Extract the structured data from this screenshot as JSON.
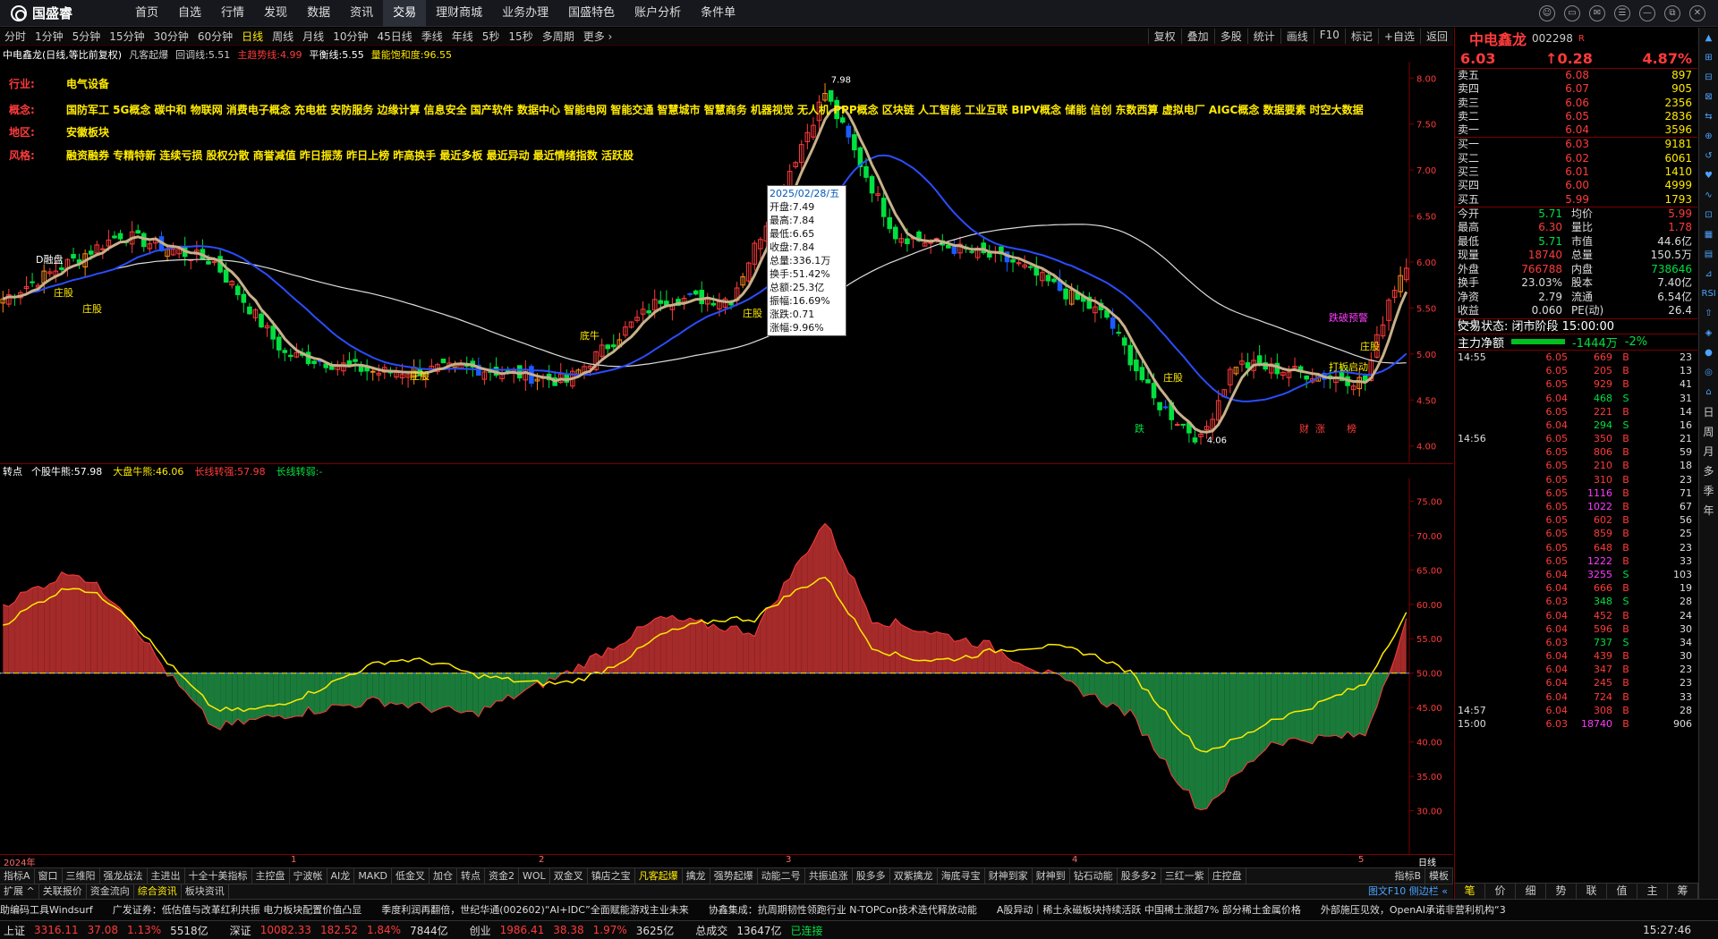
{
  "app": {
    "name": "国盛睿"
  },
  "nav": {
    "items": [
      "首页",
      "自选",
      "行情",
      "发现",
      "数据",
      "资讯",
      "交易",
      "理财商城",
      "业务办理",
      "国盛特色",
      "账户分析",
      "条件单"
    ],
    "active": 6,
    "window_controls": [
      "☺",
      "▭",
      "✉",
      "☰",
      "—",
      "⧉",
      "✕"
    ]
  },
  "periods": {
    "items": [
      "分时",
      "1分钟",
      "5分钟",
      "15分钟",
      "30分钟",
      "60分钟",
      "日线",
      "周线",
      "月线",
      "10分钟",
      "45日线",
      "季线",
      "年线",
      "5秒",
      "15秒",
      "多周期",
      "更多 ›"
    ],
    "active": 6
  },
  "tools": [
    "复权",
    "叠加",
    "多股",
    "统计",
    "画线",
    "F10",
    "标记",
    "+自选",
    "返回"
  ],
  "info": {
    "stock": "中电鑫龙(日线,等比前复权)",
    "indicator": "凡客起爆",
    "items": [
      {
        "k": "回调线:",
        "v": "5.51"
      },
      {
        "k": "主趋势线:",
        "v": "4.99"
      },
      {
        "k": "平衡线:",
        "v": "5.55"
      },
      {
        "k": "量能饱和度:",
        "v": "96.55"
      }
    ]
  },
  "annotations": [
    {
      "k": "行业:",
      "v": "电气设备"
    },
    {
      "k": "概念:",
      "v": "国防军工 5G概念 碳中和 物联网 消费电子概念 充电桩 安防服务 边缘计算 信息安全 国产软件 数据中心 智能电网 智能交通 智慧城市 智慧商务 机器视觉 无人机 PPP概念 区块链 人工智能 工业互联 BIPV概念 储能 信创 东数西算 虚拟电厂 AIGC概念 数据要素 时空大数据"
    },
    {
      "k": "地区:",
      "v": "安徽板块"
    },
    {
      "k": "风格:",
      "v": "融资融券 专精特新 连续亏损 股权分散 商誉减值 昨日振荡 昨日上榜 昨高换手 最近多板 最近异动 最近情绪指数 活跃股"
    }
  ],
  "chart_data": [
    {
      "type": "candlestick",
      "ylim": [
        3.9,
        8.1
      ],
      "yticks": [
        "8.00",
        "7.50",
        "7.00",
        "6.50",
        "6.00",
        "5.50",
        "5.00",
        "4.50",
        "4.00"
      ],
      "high_label": "7.98",
      "low_label": "4.06",
      "marks": [
        "D融盘",
        "庄股",
        "庄股",
        "庄股",
        "底牛",
        "庄股",
        "庄股",
        "跌破预警",
        "庄股",
        "打板启动",
        "跌",
        "财",
        "涨",
        "榜"
      ]
    },
    {
      "type": "area",
      "ylim": [
        25,
        77
      ],
      "yticks": [
        "75.00",
        "70.00",
        "65.00",
        "60.00",
        "55.00",
        "50.00",
        "45.00",
        "40.00",
        "35.00",
        "30.00"
      ],
      "series": [
        {
          "name": "个股牛熊",
          "last": "57.98",
          "color": "#ffffff"
        },
        {
          "name": "大盘牛熊",
          "last": "46.06",
          "color": "#ffea00"
        },
        {
          "name": "长线转强",
          "last": "57.98",
          "color": "#ff3b3b"
        },
        {
          "name": "长线转弱",
          "last": "-",
          "color": "#00e040"
        }
      ],
      "baseline": 50
    }
  ],
  "tooltip": {
    "date": "2025/02/28/五",
    "rows": [
      "开盘:7.49",
      "最高:7.84",
      "最低:6.65",
      "收盘:7.84",
      "总量:336.1万",
      "换手:51.42%",
      "总额:25.3亿",
      "振幅:16.69%",
      "涨跌:0.71",
      "涨幅:9.96%"
    ]
  },
  "subinfo": {
    "title": "转点",
    "items": [
      {
        "k": "个股牛熊:",
        "v": "57.98",
        "c": "#fff"
      },
      {
        "k": "大盘牛熊:",
        "v": "46.06",
        "c": "#ffea00"
      },
      {
        "k": "长线转强:",
        "v": "57.98",
        "c": "#ff3b3b"
      },
      {
        "k": "长线转弱:",
        "v": "-",
        "c": "#00e040"
      }
    ]
  },
  "timeaxis": {
    "labels": [
      "2024年",
      "1",
      "2",
      "3",
      "4",
      "5"
    ],
    "right": "日线"
  },
  "tabs1": {
    "items": [
      "指标A",
      "窗口",
      "三维阳",
      "强龙战法",
      "主进出",
      "十全十美指标",
      "主控盘",
      "宁波帐",
      "AI龙",
      "MAKD",
      "低金叉",
      "加仓",
      "转点",
      "资金2",
      "WOL",
      "双金叉",
      "镇店之宝",
      "凡客起爆",
      "擒龙",
      "强势起爆",
      "动能二号",
      "共振追涨",
      "股多多",
      "双紫擒龙",
      "海底寻宝",
      "财神到家",
      "财神到",
      "钻石动能",
      "股多多2",
      "三红一紫",
      "庄控盘"
    ],
    "active": 17,
    "right": [
      "指标B",
      "模板"
    ]
  },
  "tabs2": {
    "items": [
      "扩展 ^",
      "关联报价",
      "资金流向",
      "综合资讯",
      "板块资讯"
    ],
    "right": "图文F10 侧边栏 «"
  },
  "news": [
    "助编码工具Windsurf",
    "广发证券：低估值与改革红利共振 电力板块配置价值凸显",
    "季度利润再翻倍，世纪华通(002602)“AI+IDC”全面赋能游戏主业未来",
    "协鑫集成：抗周期韧性领跑行业 N-TOPCon技术迭代释放动能",
    "A股异动｜稀土永磁板块持续活跃 中国稀土涨超7% 部分稀土金属价格",
    "外部施压见效，OpenAI承诺非营利机构“3"
  ],
  "status": {
    "indices": [
      {
        "name": "上证",
        "val": "3316.11",
        "chg": "37.08",
        "pct": "1.13%",
        "amt": "5518亿"
      },
      {
        "name": "深证",
        "val": "10082.33",
        "chg": "182.52",
        "pct": "1.84%",
        "amt": "7844亿"
      },
      {
        "name": "创业",
        "val": "1986.41",
        "chg": "38.38",
        "pct": "1.97%",
        "amt": "3625亿"
      }
    ],
    "total_label": "总成交",
    "total": "13647亿",
    "conn": "已连接",
    "time": "15:27:46"
  },
  "quote": {
    "name": "中电鑫龙",
    "code": "002298",
    "tag": "R",
    "price": "6.03",
    "change": "0.28",
    "pct": "4.87%",
    "asks": [
      {
        "l": "卖五",
        "p": "6.08",
        "v": "897"
      },
      {
        "l": "卖四",
        "p": "6.07",
        "v": "905"
      },
      {
        "l": "卖三",
        "p": "6.06",
        "v": "2356"
      },
      {
        "l": "卖二",
        "p": "6.05",
        "v": "2836"
      },
      {
        "l": "卖一",
        "p": "6.04",
        "v": "3596"
      }
    ],
    "bids": [
      {
        "l": "买一",
        "p": "6.03",
        "v": "9181"
      },
      {
        "l": "买二",
        "p": "6.02",
        "v": "6061"
      },
      {
        "l": "买三",
        "p": "6.01",
        "v": "1410"
      },
      {
        "l": "买四",
        "p": "6.00",
        "v": "4999"
      },
      {
        "l": "买五",
        "p": "5.99",
        "v": "1793"
      }
    ],
    "stats": [
      {
        "k": "今开",
        "a": "5.71",
        "ac": "#00e040",
        "k2": "均价",
        "b": "5.99",
        "bc": "#ff3b3b"
      },
      {
        "k": "最高",
        "a": "6.30",
        "ac": "#ff3b3b",
        "k2": "量比",
        "b": "1.78",
        "bc": "#ff3b3b"
      },
      {
        "k": "最低",
        "a": "5.71",
        "ac": "#00e040",
        "k2": "市值",
        "b": "44.6亿",
        "bc": "#ddd"
      },
      {
        "k": "现量",
        "a": "18740",
        "ac": "#ff3b3b",
        "k2": "总量",
        "b": "150.5万",
        "bc": "#ddd"
      },
      {
        "k": "外盘",
        "a": "766788",
        "ac": "#ff3b3b",
        "k2": "内盘",
        "b": "738646",
        "bc": "#00e040"
      },
      {
        "k": "换手",
        "a": "23.03%",
        "ac": "#ddd",
        "k2": "股本",
        "b": "7.40亿",
        "bc": "#ddd"
      },
      {
        "k": "净资",
        "a": "2.79",
        "ac": "#ddd",
        "k2": "流通",
        "b": "6.54亿",
        "bc": "#ddd"
      },
      {
        "k": "收益(一)",
        "a": "0.060",
        "ac": "#ddd",
        "k2": "PE(动)",
        "b": "26.4",
        "bc": "#ddd"
      }
    ],
    "trade_state": "交易状态: 闭市阶段 15:00:00",
    "netflow": {
      "label": "主力净额",
      "val": "-1444万",
      "pct": "-2%"
    },
    "ticks": [
      {
        "t": "14:55",
        "p": "6.05",
        "v": "669",
        "s": "B",
        "n": "23"
      },
      {
        "t": "",
        "p": "6.05",
        "v": "205",
        "s": "B",
        "n": "13"
      },
      {
        "t": "",
        "p": "6.05",
        "v": "929",
        "s": "B",
        "n": "41"
      },
      {
        "t": "",
        "p": "6.04",
        "v": "468",
        "s": "S",
        "n": "31"
      },
      {
        "t": "",
        "p": "6.05",
        "v": "221",
        "s": "B",
        "n": "14"
      },
      {
        "t": "",
        "p": "6.04",
        "v": "294",
        "s": "S",
        "n": "16"
      },
      {
        "t": "14:56",
        "p": "6.05",
        "v": "350",
        "s": "B",
        "n": "21"
      },
      {
        "t": "",
        "p": "6.05",
        "v": "806",
        "s": "B",
        "n": "59"
      },
      {
        "t": "",
        "p": "6.05",
        "v": "210",
        "s": "B",
        "n": "18"
      },
      {
        "t": "",
        "p": "6.05",
        "v": "310",
        "s": "B",
        "n": "23"
      },
      {
        "t": "",
        "p": "6.05",
        "v": "1116",
        "s": "B",
        "n": "71"
      },
      {
        "t": "",
        "p": "6.05",
        "v": "1022",
        "s": "B",
        "n": "67"
      },
      {
        "t": "",
        "p": "6.05",
        "v": "602",
        "s": "B",
        "n": "56"
      },
      {
        "t": "",
        "p": "6.05",
        "v": "859",
        "s": "B",
        "n": "25"
      },
      {
        "t": "",
        "p": "6.05",
        "v": "648",
        "s": "B",
        "n": "23"
      },
      {
        "t": "",
        "p": "6.05",
        "v": "1222",
        "s": "B",
        "n": "33"
      },
      {
        "t": "",
        "p": "6.04",
        "v": "3255",
        "s": "S",
        "n": "103"
      },
      {
        "t": "",
        "p": "6.04",
        "v": "666",
        "s": "B",
        "n": "19"
      },
      {
        "t": "",
        "p": "6.03",
        "v": "348",
        "s": "S",
        "n": "28"
      },
      {
        "t": "",
        "p": "6.04",
        "v": "452",
        "s": "B",
        "n": "24"
      },
      {
        "t": "",
        "p": "6.04",
        "v": "596",
        "s": "B",
        "n": "30"
      },
      {
        "t": "",
        "p": "6.03",
        "v": "737",
        "s": "S",
        "n": "34"
      },
      {
        "t": "",
        "p": "6.04",
        "v": "439",
        "s": "B",
        "n": "30"
      },
      {
        "t": "",
        "p": "6.04",
        "v": "347",
        "s": "B",
        "n": "23"
      },
      {
        "t": "",
        "p": "6.04",
        "v": "245",
        "s": "B",
        "n": "23"
      },
      {
        "t": "",
        "p": "6.04",
        "v": "724",
        "s": "B",
        "n": "33"
      },
      {
        "t": "14:57",
        "p": "6.04",
        "v": "308",
        "s": "B",
        "n": "28"
      },
      {
        "t": "15:00",
        "p": "6.03",
        "v": "18740",
        "s": "B",
        "n": "906"
      }
    ],
    "tabs": [
      "笔",
      "价",
      "细",
      "势",
      "联",
      "值",
      "主",
      "筹"
    ],
    "active_tab": 0
  },
  "sidestrip": [
    "▲",
    "⊞",
    "⊟",
    "⊠",
    "⇆",
    "⊕",
    "↺",
    "♥",
    "∿",
    "⊡",
    "▦",
    "▤",
    "⊿",
    "RSI",
    "⇧",
    "◈",
    "●",
    "◎",
    "⌂"
  ],
  "side_text": [
    "日",
    "周",
    "月",
    "多",
    "季",
    "年"
  ]
}
